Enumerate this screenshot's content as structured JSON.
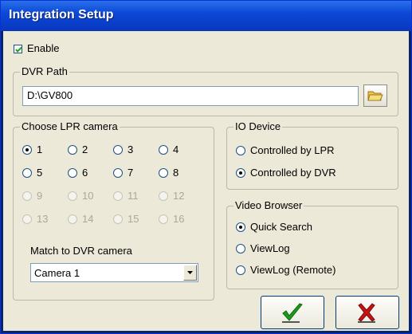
{
  "window": {
    "title": "Integration Setup"
  },
  "enable": {
    "label": "Enable",
    "checked": true
  },
  "dvr_path": {
    "group_label": "DVR Path",
    "value": "D:\\GV800",
    "browse_icon": "folder-open-icon"
  },
  "lpr_camera": {
    "group_label": "Choose LPR camera",
    "options": [
      "1",
      "2",
      "3",
      "4",
      "5",
      "6",
      "7",
      "8",
      "9",
      "10",
      "11",
      "12",
      "13",
      "14",
      "15",
      "16"
    ],
    "selected": "1",
    "enabled_count": 8,
    "match_label": "Match to DVR camera",
    "match_value": "Camera 1"
  },
  "io_device": {
    "group_label": "IO Device",
    "options": [
      "Controlled by LPR",
      "Controlled by DVR"
    ],
    "selected": "Controlled by DVR"
  },
  "video_browser": {
    "group_label": "Video Browser",
    "options": [
      "Quick Search",
      "ViewLog",
      "ViewLog (Remote)"
    ],
    "selected": "Quick Search"
  },
  "buttons": {
    "ok_icon": "checkmark-icon",
    "cancel_icon": "x-mark-icon"
  },
  "colors": {
    "title_bar": "#0b49d6",
    "face": "#ece9d8",
    "ok_green": "#1c9a1c",
    "cancel_red": "#c41414"
  }
}
